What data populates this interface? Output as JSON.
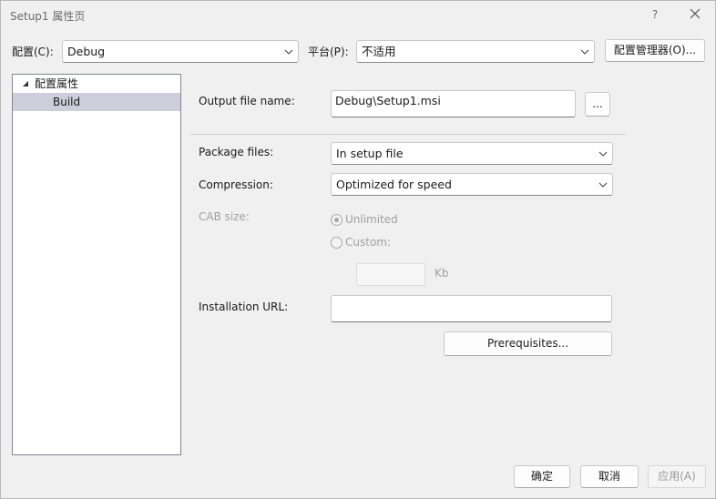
{
  "window": {
    "title": "Setup1 属性页",
    "help_glyph": "?"
  },
  "config_bar": {
    "config_label": "配置(C):",
    "config_value": "Debug",
    "platform_label": "平台(P):",
    "platform_value": "不适用",
    "manager_button": "配置管理器(O)..."
  },
  "tree": {
    "root_label": "配置属性",
    "child_label": "Build",
    "selected": "Build"
  },
  "build": {
    "output_label": "Output file name:",
    "output_value": "Debug\\Setup1.msi",
    "browse_button": "...",
    "package_label": "Package files:",
    "package_value": "In setup file",
    "compression_label": "Compression:",
    "compression_value": "Optimized for speed",
    "cab_label": "CAB size:",
    "unlimited_label": "Unlimited",
    "custom_label": "Custom:",
    "custom_value": "",
    "kb_label": "Kb",
    "install_url_label": "Installation URL:",
    "install_url_value": "",
    "prerequisites_button": "Prerequisites..."
  },
  "footer": {
    "ok_button": "确定",
    "cancel_button": "取消",
    "apply_button": "应用(A)"
  },
  "colors": {
    "selection": "#cccedb",
    "window_bg": "#f0f0f0",
    "disabled_text": "#a0a0a0"
  }
}
